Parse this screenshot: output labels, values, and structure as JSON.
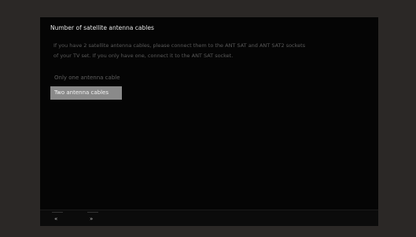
{
  "dialog": {
    "title": "Number of satellite antenna cables",
    "description_lines": [
      "If you have 2 satellite antenna cables, please connect them to the ANT SAT and ANT SAT2 sockets",
      "of your TV set. If you only have one, connect it to the ANT SAT socket."
    ],
    "options": [
      {
        "label": "Only one antenna cable",
        "selected": false
      },
      {
        "label": "Two antenna cables",
        "selected": true
      }
    ]
  },
  "footer": {
    "back_glyph": "«",
    "forward_glyph": "»"
  },
  "colors": {
    "bezel": "#2b2826",
    "screen": "#050505",
    "highlight": "#8a8a8a"
  }
}
